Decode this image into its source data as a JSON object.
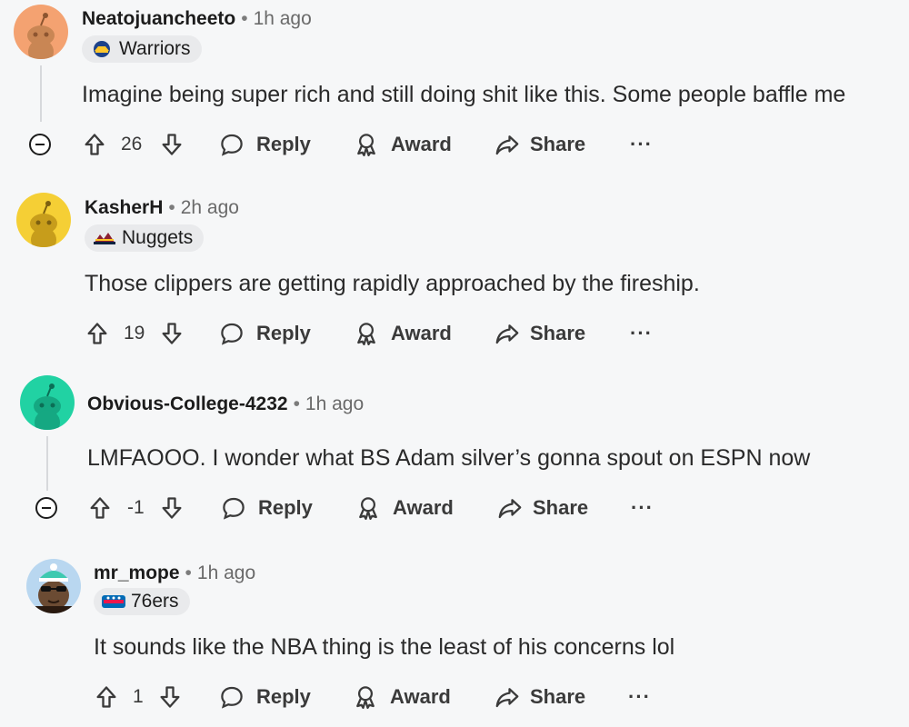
{
  "comments": [
    {
      "username": "Neatojuancheeto",
      "time": "1h ago",
      "flair": "Warriors",
      "avatar_color": "#f4a271",
      "text": "Imagine being super rich and still doing shit like this. Some people baffle me",
      "score": "26",
      "reply": "Reply",
      "award": "Award",
      "share": "Share",
      "more": "···"
    },
    {
      "username": "KasherH",
      "time": "2h ago",
      "flair": "Nuggets",
      "avatar_color": "#f5cf35",
      "text": "Those clippers are getting rapidly approached by the fireship.",
      "score": "19",
      "reply": "Reply",
      "award": "Award",
      "share": "Share",
      "more": "···"
    },
    {
      "username": "Obvious-College-4232",
      "time": "1h ago",
      "avatar_color": "#21d2a3",
      "text": "LMFAOOO. I wonder what BS Adam silver’s gonna spout on ESPN now",
      "score": "-1",
      "reply": "Reply",
      "award": "Award",
      "share": "Share",
      "more": "···"
    },
    {
      "username": "mr_mope",
      "time": "1h ago",
      "flair": "76ers",
      "avatar_color": "#b9d7f0",
      "text": "It sounds like the NBA thing is the least of his concerns lol",
      "score": "1",
      "reply": "Reply",
      "award": "Award",
      "share": "Share",
      "more": "···"
    }
  ],
  "icons": {
    "upvote": "upvote-arrow-icon",
    "downvote": "downvote-arrow-icon",
    "reply": "speech-bubble-icon",
    "award": "award-ribbon-icon",
    "share": "share-arrow-icon",
    "collapse": "collapse-minus-icon"
  }
}
